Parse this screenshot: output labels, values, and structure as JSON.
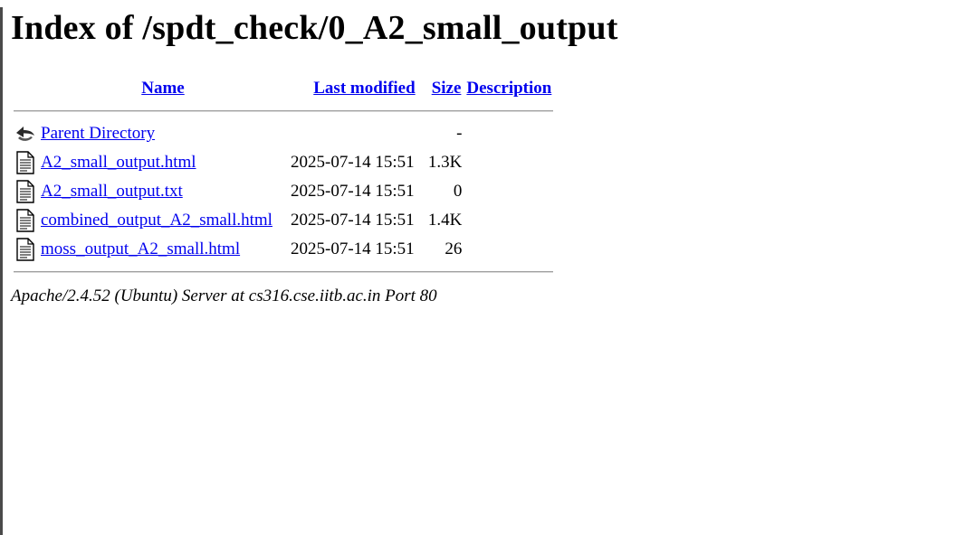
{
  "page": {
    "title": "Index of /spdt_check/0_A2_small_output"
  },
  "columns": {
    "name": "Name",
    "last_modified": "Last modified",
    "size": "Size",
    "description": "Description"
  },
  "entries": [
    {
      "icon": "back-arrow-icon",
      "name": "Parent Directory",
      "modified": "",
      "size": "-",
      "description": ""
    },
    {
      "icon": "text-file-icon",
      "name": "A2_small_output.html",
      "modified": "2025-07-14 15:51",
      "size": "1.3K",
      "description": ""
    },
    {
      "icon": "text-file-icon",
      "name": "A2_small_output.txt",
      "modified": "2025-07-14 15:51",
      "size": "0",
      "description": ""
    },
    {
      "icon": "text-file-icon",
      "name": "combined_output_A2_small.html",
      "modified": "2025-07-14 15:51",
      "size": "1.4K",
      "description": ""
    },
    {
      "icon": "text-file-icon",
      "name": "moss_output_A2_small.html",
      "modified": "2025-07-14 15:51",
      "size": "26",
      "description": ""
    }
  ],
  "footer": {
    "server": "Apache/2.4.52 (Ubuntu) Server at cs316.cse.iitb.ac.in Port 80"
  },
  "colors": {
    "link": "#0000ee",
    "text": "#000000",
    "background": "#ffffff"
  }
}
